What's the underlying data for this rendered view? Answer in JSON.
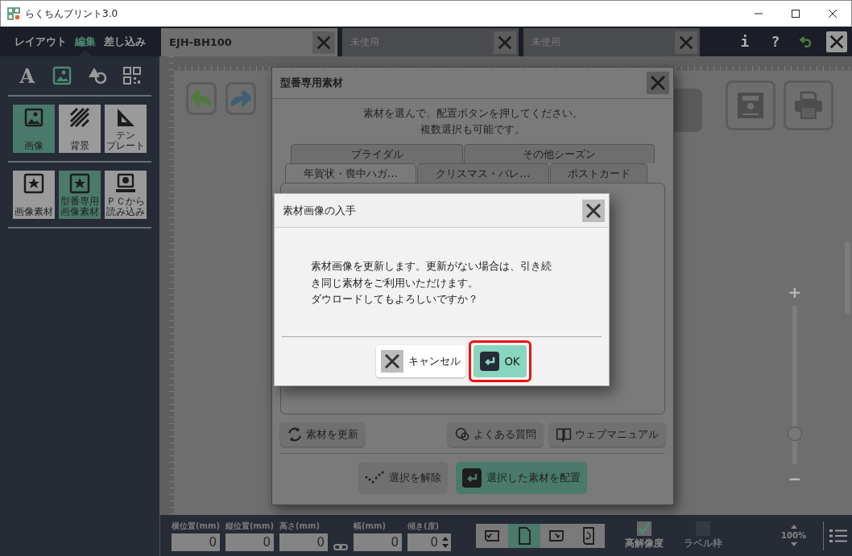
{
  "window": {
    "title": "らくちんプリント3.0"
  },
  "mode_tabs": [
    {
      "label": "レイアウト",
      "selected": false
    },
    {
      "label": "編集",
      "selected": true
    },
    {
      "label": "差し込み",
      "selected": false
    }
  ],
  "tool_icons": [
    {
      "kind": "text",
      "label": "A",
      "selected": false
    },
    {
      "kind": "image",
      "selected": true
    },
    {
      "kind": "shape",
      "selected": false
    },
    {
      "kind": "qr",
      "selected": false
    }
  ],
  "image_tools": [
    {
      "lines": [
        "画像"
      ],
      "kind": "photo",
      "selected": true
    },
    {
      "lines": [
        "背景"
      ],
      "kind": "stripes",
      "selected": false
    },
    {
      "lines": [
        "テン",
        "プレート"
      ],
      "kind": "ruler",
      "selected": false
    }
  ],
  "material_tools": [
    {
      "lines": [
        "画像素材"
      ],
      "kind": "star",
      "selected": false
    },
    {
      "lines": [
        "型番専用",
        "画像素材"
      ],
      "kind": "star",
      "selected": true
    },
    {
      "lines": [
        "ＰＣから",
        "読み込み"
      ],
      "kind": "laptop",
      "selected": false
    }
  ],
  "doc_tabs": [
    {
      "label": "EJH-BH100",
      "selected": true
    },
    {
      "label": "未使用",
      "selected": false
    },
    {
      "label": "未使用",
      "selected": false
    }
  ],
  "top_actions": [
    {
      "kind": "char",
      "label": "i"
    },
    {
      "kind": "char",
      "label": "?"
    },
    {
      "kind": "undo"
    },
    {
      "kind": "close"
    }
  ],
  "zoom": {
    "level": 0.2,
    "reading": "100%",
    "plus": "+",
    "minus": "−"
  },
  "fields": [
    {
      "label": "横位置",
      "unit": "(mm)",
      "value": "0",
      "kind": "text"
    },
    {
      "label": "縦位置",
      "unit": "(mm)",
      "value": "0",
      "kind": "text"
    },
    {
      "label": "高さ",
      "unit": "(mm)",
      "value": "0",
      "kind": "text"
    },
    {
      "label": "幅",
      "unit": "(mm)",
      "value": "0",
      "kind": "text"
    },
    {
      "label": "傾き",
      "unit": "(度)",
      "value": "0",
      "kind": "spin"
    }
  ],
  "orientation_buttons": [
    {
      "kind": "rotate-left",
      "selected": false
    },
    {
      "kind": "portrait",
      "selected": true
    },
    {
      "kind": "rotate-right",
      "selected": false
    },
    {
      "kind": "flip",
      "selected": false
    }
  ],
  "options": [
    {
      "label": "高解像度",
      "checked": true,
      "disabled": false
    },
    {
      "label": "ラベル枠",
      "checked": false,
      "disabled": true
    }
  ],
  "material_dialog": {
    "title": "型番専用素材",
    "instructions": [
      "素材を選んで、配置ボタンを押してください。",
      "複数選択も可能です。"
    ],
    "tabs_back": [
      {
        "label": "ブライダル",
        "selected": false
      },
      {
        "label": "その他シーズン",
        "selected": false
      }
    ],
    "tabs_front": [
      {
        "label": "年賀状・喪中ハガ…",
        "selected": true
      },
      {
        "label": "クリスマス・バレ…",
        "selected": false
      },
      {
        "label": "ポストカード",
        "selected": false
      }
    ],
    "links": [
      {
        "kind": "refresh",
        "label": "素材を更新"
      },
      {
        "kind": "faq",
        "label": "よくある質問"
      },
      {
        "kind": "manual",
        "label": "ウェブマニュアル"
      }
    ],
    "deselect": "選択を解除",
    "place": "選択した素材を配置"
  },
  "confirm_dialog": {
    "title": "素材画像の入手",
    "message": "素材画像を更新します。更新がない場合は、引き続き同じ素材をご利用いただけます。",
    "question": "ダウロードしてもよろしいですか？",
    "cancel": "キャンセル",
    "ok": "OK",
    "ok_highlighted": true
  }
}
